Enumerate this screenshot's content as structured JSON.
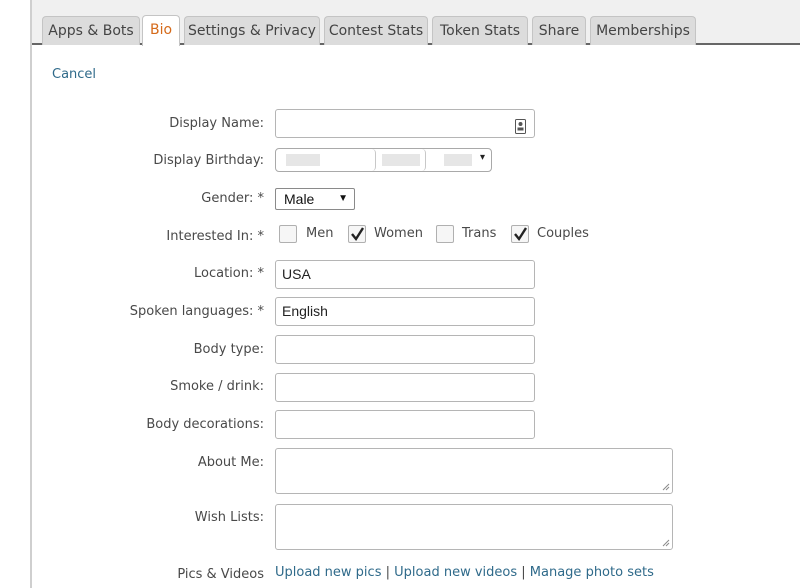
{
  "tabs": [
    "Apps & Bots",
    "Bio",
    "Settings & Privacy",
    "Contest Stats",
    "Token Stats",
    "Share",
    "Memberships"
  ],
  "active_tab": "Bio",
  "cancel_label": "Cancel",
  "form": {
    "display_name_label": "Display Name:",
    "display_birthday_label": "Display Birthday:",
    "gender_label": "Gender: *",
    "gender_value": "Male",
    "interested_label": "Interested In: *",
    "interests": [
      {
        "label": "Men",
        "checked": false
      },
      {
        "label": "Women",
        "checked": true
      },
      {
        "label": "Trans",
        "checked": false
      },
      {
        "label": "Couples",
        "checked": true
      }
    ],
    "location_label": "Location: *",
    "location_value": "USA",
    "languages_label": "Spoken languages: *",
    "languages_value": "English",
    "body_type_label": "Body type:",
    "smoke_drink_label": "Smoke / drink:",
    "body_decorations_label": "Body decorations:",
    "about_me_label": "About Me:",
    "wish_lists_label": "Wish Lists:",
    "pics_videos_label": "Pics & Videos",
    "upload_pics": "Upload new pics",
    "upload_videos": "Upload new videos",
    "manage_sets": "Manage photo sets",
    "link_separator": "|"
  },
  "colors": {
    "active_tab_text": "#d56a1a",
    "link": "#2f6a8a",
    "tab_underline": "#666666"
  }
}
